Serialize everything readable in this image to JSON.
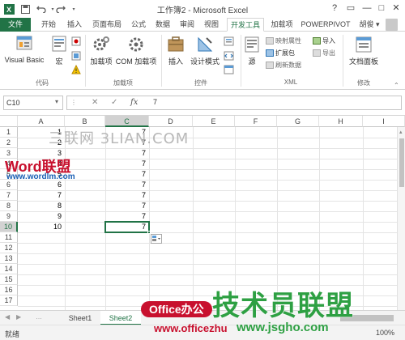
{
  "titlebar": {
    "title": "工作簿2 - Microsoft Excel",
    "help": "?",
    "restore": "▭",
    "minimize": "—",
    "maximize": "□",
    "close": "✕"
  },
  "tabs": {
    "file": "文件",
    "items": [
      "开始",
      "插入",
      "页面布局",
      "公式",
      "数据",
      "审阅",
      "视图",
      "开发工具",
      "加载项",
      "POWERPIVOT"
    ],
    "user": "胡俊 ▾"
  },
  "ribbon": {
    "code": {
      "visual_basic": "Visual Basic",
      "macro": "宏",
      "label": "代码"
    },
    "addins": {
      "addins": "加载项",
      "com": "COM 加载项",
      "label": "加载项"
    },
    "controls": {
      "insert": "插入",
      "design": "设计模式",
      "label": "控件"
    },
    "xml": {
      "source": "源",
      "map_props": "映射属性",
      "expansion": "扩展包",
      "refresh": "刷新数据",
      "import": "导入",
      "export": "导出",
      "label": "XML"
    },
    "modify": {
      "doc_panel": "文档面板",
      "label": "修改"
    }
  },
  "formula_bar": {
    "name_box": "C10",
    "cancel": "✕",
    "enter": "✓",
    "fx": "fx",
    "value": "7"
  },
  "grid": {
    "columns": [
      "A",
      "B",
      "C",
      "D",
      "E",
      "F",
      "G",
      "H",
      "I"
    ],
    "rows": [
      "1",
      "2",
      "3",
      "4",
      "5",
      "6",
      "7",
      "8",
      "9",
      "10",
      "11",
      "12",
      "13",
      "14",
      "15",
      "16",
      "17"
    ],
    "col_a": [
      "1",
      "2",
      "3",
      "4",
      "5",
      "6",
      "7",
      "8",
      "9",
      "10"
    ],
    "col_c": [
      "7",
      "7",
      "7",
      "7",
      "7",
      "7",
      "7",
      "7",
      "7",
      "7"
    ]
  },
  "sheets": [
    "Sheet1",
    "Sheet2"
  ],
  "status": {
    "ready": "就绪",
    "zoom": "100%"
  },
  "watermarks": {
    "sanlian": "三联网 3LIAN.COM",
    "word_logo": "Word联盟",
    "word_url": "www.wordlm.com",
    "office": "Office办公",
    "office_url": "www.officezhu",
    "jishu": "技术员联盟",
    "jsgho": "www.jsgho.com"
  },
  "colors": {
    "excel_green": "#217346",
    "selection": "#217346",
    "word_red": "#c8102e",
    "word_blue": "#1a5fb4",
    "jsgho_green": "#2ea043"
  }
}
